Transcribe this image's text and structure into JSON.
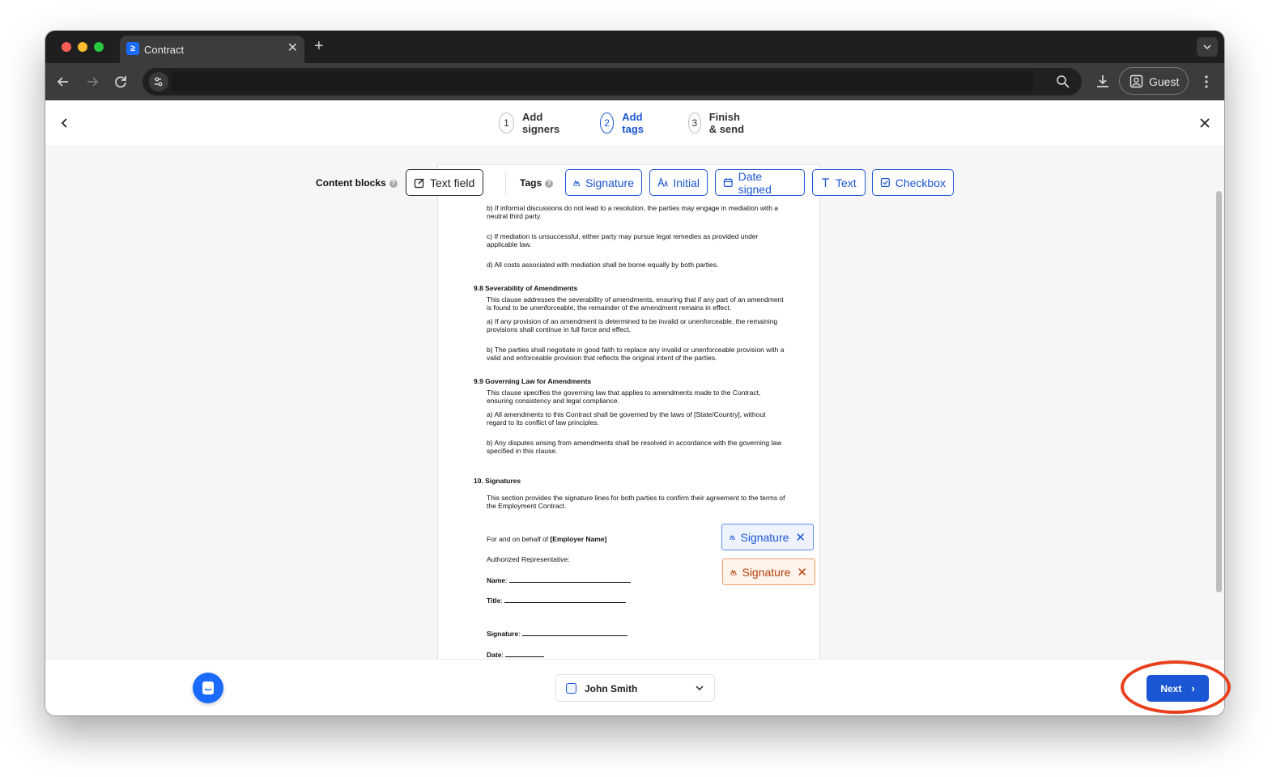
{
  "browser": {
    "tab_title": "Contract",
    "new_tab_icon": "+",
    "profile_label": "Guest"
  },
  "wizard": {
    "steps": [
      {
        "number": "1",
        "label": "Add signers"
      },
      {
        "number": "2",
        "label": "Add tags"
      },
      {
        "number": "3",
        "label": "Finish & send"
      }
    ],
    "active_step": 2
  },
  "blocks": {
    "content_blocks_label": "Content blocks",
    "text_field_label": "Text field",
    "tags_label": "Tags",
    "tags": [
      {
        "label": "Signature",
        "icon": "signature-icon"
      },
      {
        "label": "Initial",
        "icon": "initial-icon"
      },
      {
        "label": "Date signed",
        "icon": "calendar-icon"
      },
      {
        "label": "Text",
        "icon": "text-icon"
      },
      {
        "label": "Checkbox",
        "icon": "checkbox-icon"
      }
    ]
  },
  "document": {
    "paras": [
      "b) If informal discussions do not lead to a resolution, the parties may engage in mediation with a neutral third party.",
      "c) If mediation is unsuccessful, either party may pursue legal remedies as provided under applicable law.",
      "d) All costs associated with mediation shall be borne equally by both parties.",
      "9.8 Severability of Amendments",
      "This clause addresses the severability of amendments, ensuring that if any part of an amendment is found to be unenforceable, the remainder of the amendment remains in effect.",
      "a) If any provision of an amendment is determined to be invalid or unenforceable, the remaining provisions shall continue in full force and effect.",
      "b) The parties shall negotiate in good faith to replace any invalid or unenforceable provision with a valid and enforceable provision that reflects the original intent of the parties.",
      "9.9 Governing Law for Amendments",
      "This clause specifies the governing law that applies to amendments made to the Contract, ensuring consistency and legal compliance.",
      "a) All amendments to this Contract shall be governed by the laws of [State/Country], without regard to its conflict of law principles.",
      "b) Any disputes arising from amendments shall be resolved in accordance with the governing law specified in this clause.",
      "10. Signatures",
      "This section provides the signature lines for both parties to confirm their agreement to the terms of the Employment Contract."
    ],
    "behalf_prefix": "For and on behalf of ",
    "behalf_name": "[Employer Name]",
    "authorized": "Authorized Representative:",
    "name_label": "Name",
    "title_label": "Title",
    "signature_label": "Signature",
    "date_label": "Date"
  },
  "placed_tags": [
    {
      "label": "Signature",
      "color": "#1b56d4"
    },
    {
      "label": "Signature",
      "color": "#b5410d"
    }
  ],
  "footer": {
    "signer_name": "John Smith",
    "next_label": "Next"
  },
  "colors": {
    "accent": "#1b56d4",
    "highlight_ring": "#e8401c"
  }
}
